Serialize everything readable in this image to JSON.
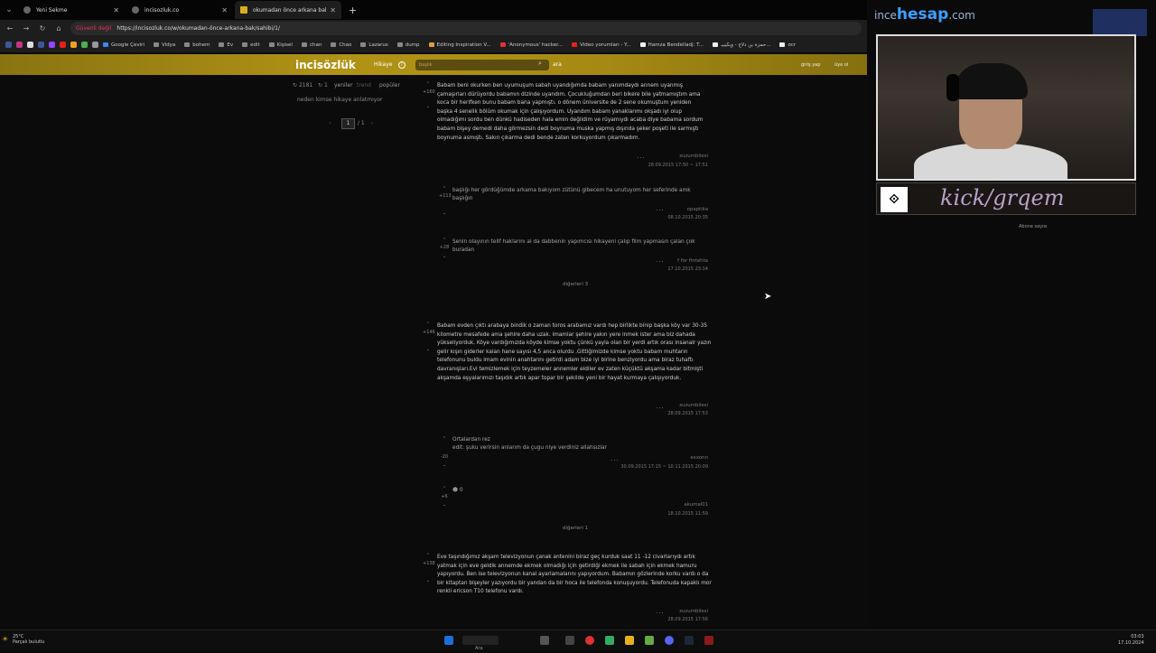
{
  "browser": {
    "tabs": [
      {
        "label": "Yeni Sekme",
        "active": false
      },
      {
        "label": "incisozluk.co",
        "active": false
      },
      {
        "label": "okumadan önce arkana bak - İ",
        "active": true
      }
    ],
    "security_label": "Güvenli değil",
    "url": "https://incisozluk.co/w/okumadan-önce-arkana-bak/sahibi/1/",
    "bookmarks": [
      "Google Çeviri",
      "Vidya",
      "bohem",
      "Ev",
      "edit",
      "Kişisel",
      "chan",
      "Chao",
      "Lazarus",
      "dump",
      "Editing Inspiration V...",
      "'Anonymous' hacker...",
      "Video yorumları - Y...",
      "Hamza Bendelladj: T...",
      "حمزة بن دلاج - ويكيبيـ...",
      "ocr"
    ]
  },
  "site": {
    "logo": "incisözlük",
    "hikaye": "Hikaye",
    "search_placeholder": "başlık",
    "search_button": "ara",
    "login": "giriş yap",
    "register": "üye ol",
    "sidebar": {
      "count": "2181",
      "refresh": "1",
      "links": [
        "yeniler",
        "trend",
        "popüler"
      ],
      "topic": "neden kimse hikaye anlatmıyor",
      "page_current": "1",
      "page_total": "/ 1"
    }
  },
  "entries": [
    {
      "votes": "+160",
      "text": "Babam beni okurken ben uyumuşum sabah uyandığımda babam yanımdaydı annem uyanmış çamaşırları dürüyordu babamın dizinde uyandım. Çocukluğumdan beri bikere bile yatmamıştım ama koca bir herifken bunu babam bana yapmıştı. o dönem üniversite de 2 sene okumuştum yeniden başka 4 senelik bölüm okumak için çalışıyordum. Uyandım babam yanaklarımı okşadı iyi olup olmadığımı sordu ben dünkü hadiseden hala emin değildim ve rüyamıydı acaba diye babama sordum babam bişey demedi daha görmezsin dedi boynuma muska yapmış dışında şeker poşeti ile sarmıştı boynuma asmıştı. Sakın çıkarma dedi bende zaten korkuyordum çıkarmadım.",
      "author": "zuzumbilesi",
      "date": "28.09.2015 17:50 ~ 17:51"
    },
    {
      "votes": "+146",
      "text": "Babam evden çıktı arabaya bindik o zaman toros arabamız vardı hep birlikte binip başka köy var 30-35 kilometre mesafede ama şehire daha uzak. imamlar şehire yakın yere inmek ister ama biz dahada yükseliyorduk. Köye vardığımızda köyde kimse yoktu çünkü yayla olan bir yerdi artık orası insanalr yazın gelir kışın giderler kalan hane sayısı 4,5 anca olurdu .Gittiğimizde kimse yoktu babam muhtarın telefonunu buldu imam evinin anahtarını getirdi adam bize iyi birine benziyordu ama biraz tuhaftı davranışları.Evi temizlemek için teyzemeler annemler eldiler ev zaten küçüktü akşama kadar bitmişti akşamda eşyalarımızı taşıdık artık apar topar bir şekilde yeni bir hayat kurmaya çalışıyorduk.",
      "author": "zuzumbilesi",
      "date": "28.09.2015 17:53"
    },
    {
      "votes": "+138",
      "text": "Eve taşındığımız akşam televizyonun çanak antenini biraz geç kurduk saat 11 -12 civarlarıydı artık yatmak için eve geldik annemde ekmek olmadığı için getirdiği ekmek ile sabah için ekmek hamuru yapıyordu. Ben ise televizyonun kanal ayarlamalarını yapıyordum. Babamın gözlerinde korku vardı o da bir kitaptan bişeyler yazıyordu bir yandan da bir hoca ile telefonda konuşuyordu. Telefonuda kapaklı mor renkli ericson T10 telefonu vardı.",
      "author": "zuzumbilesi",
      "date": "28.09.2015 17:56"
    }
  ],
  "comments": [
    {
      "votes": "+113",
      "text": "başlığı her gördüğümde arkama bakıyom zütünü gibecem ha unutuyom her seferinde amk başlığın",
      "author": "opaptika",
      "date": "08.10.2015 20:35"
    },
    {
      "votes": "+28",
      "text": "Senin olayının telif haklarını al da dabbenin yapımcısı hikayeni çalıp film yapmasın çalan çok buradan",
      "author": "f for fintehta",
      "date": "17.10.2015 23:14"
    },
    {
      "votes": "-20",
      "text": "Ortalardan rez\nedit: şuku verirsin anlarım da çugu niye verdiniz allahsızlar",
      "author": "exxonn",
      "date": "30.09.2015 17:15 ~ 10.11.2015 20:09"
    },
    {
      "votes": "+6",
      "text": "☻ 0",
      "author": "akumal01",
      "date": "18.10.2015 11:59"
    }
  ],
  "others": [
    "diğerleri 3",
    "diğerleri 1"
  ],
  "overlay": {
    "brand_pre": "ince",
    "brand_bold": "hesap",
    "brand_post": ".com",
    "kick_handle": "kick/grqem",
    "subscriber_label": "Abone sayısı"
  },
  "taskbar": {
    "weather_temp": "25°C",
    "weather_desc": "Parçalı bulutlu",
    "search_label": "Ara",
    "time": "03:03",
    "date": "17.10.2024"
  },
  "colors": {
    "header_gold": "#b19315",
    "brand_blue": "#3aa0ff"
  }
}
